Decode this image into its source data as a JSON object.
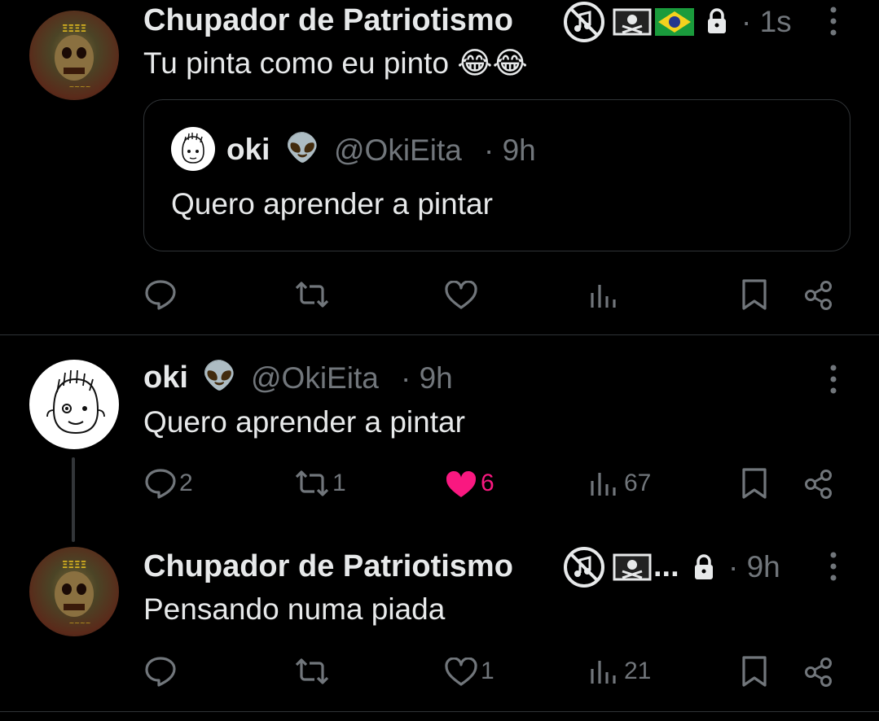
{
  "tweet1": {
    "display_name": "Chupador de Patriotismo",
    "badges": [
      "no-music-icon",
      "pirate-flag-icon",
      "brazil-flag-icon",
      "lock-icon"
    ],
    "time": "· 1s",
    "text": "Tu pinta como eu pinto 😂😂",
    "quote": {
      "display_name": "oki",
      "emoji": "👽",
      "handle": "@OkiEita",
      "time": "· 9h",
      "text": "Quero aprender a pintar"
    },
    "actions": {
      "reply": "",
      "retweet": "",
      "like": "",
      "views": ""
    }
  },
  "tweet2": {
    "display_name": "oki",
    "emoji": "👽",
    "handle": "@OkiEita",
    "time": "· 9h",
    "text": "Quero aprender a pintar",
    "actions": {
      "reply": "2",
      "retweet": "1",
      "like": "6",
      "views": "67"
    },
    "liked": true
  },
  "tweet3": {
    "display_name": "Chupador de Patriotismo",
    "ellipsis": "...",
    "time": "· 9h",
    "text": "Pensando numa piada",
    "actions": {
      "reply": "",
      "retweet": "",
      "like": "1",
      "views": "21"
    }
  },
  "colors": {
    "background": "#000000",
    "text": "#e7e9ea",
    "muted": "#71767b",
    "like": "#f91880",
    "border": "#2f3336"
  }
}
